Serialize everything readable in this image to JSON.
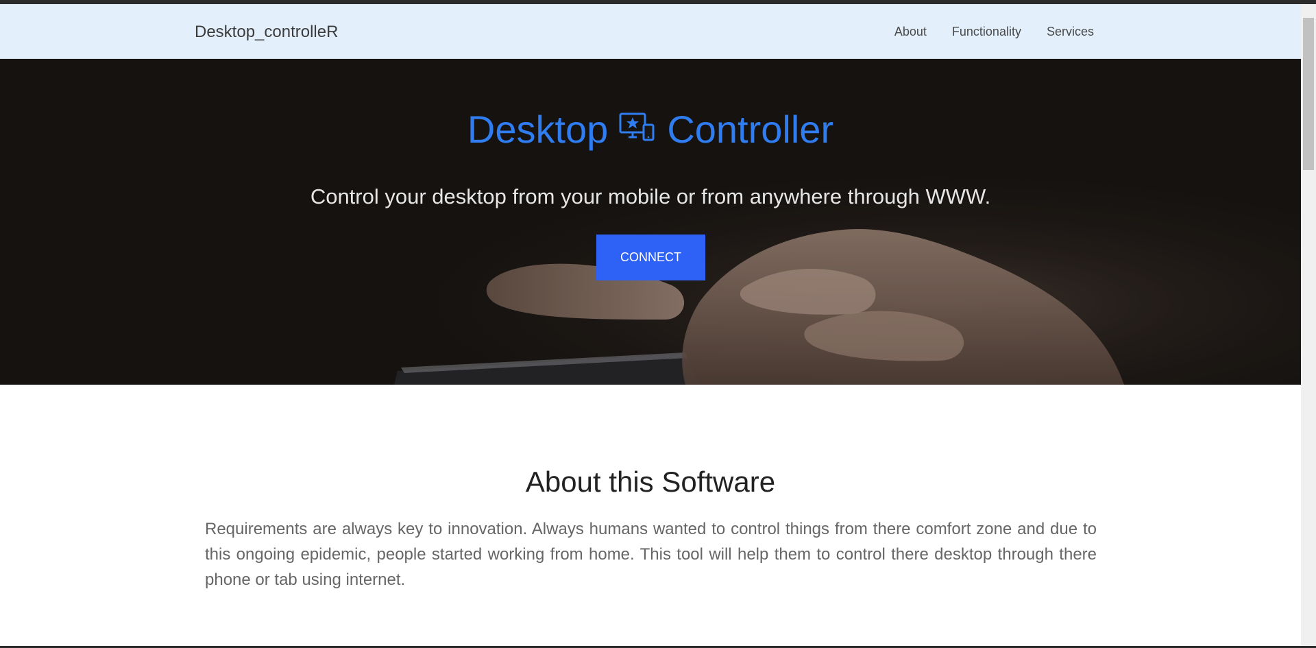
{
  "navbar": {
    "brand": "Desktop_controlleR",
    "links": [
      {
        "label": "About"
      },
      {
        "label": "Functionality"
      },
      {
        "label": "Services"
      }
    ]
  },
  "hero": {
    "title_left": "Desktop",
    "title_right": "Controller",
    "title_icon": "desktop-mobile-icon",
    "subtitle": "Control your desktop from your mobile or from anywhere through WWW.",
    "button_label": "CONNECT"
  },
  "about": {
    "title": "About this Software",
    "text": "Requirements are always key to innovation. Always humans wanted to control things from there comfort zone and due to this ongoing epidemic, people started working from home. This tool will help them to control there desktop through there phone or tab using internet."
  },
  "colors": {
    "navbar_bg": "#e3f0fb",
    "accent_blue": "#2f7df0",
    "button_blue": "#2e61f5",
    "hero_bg": "#1a1613"
  }
}
